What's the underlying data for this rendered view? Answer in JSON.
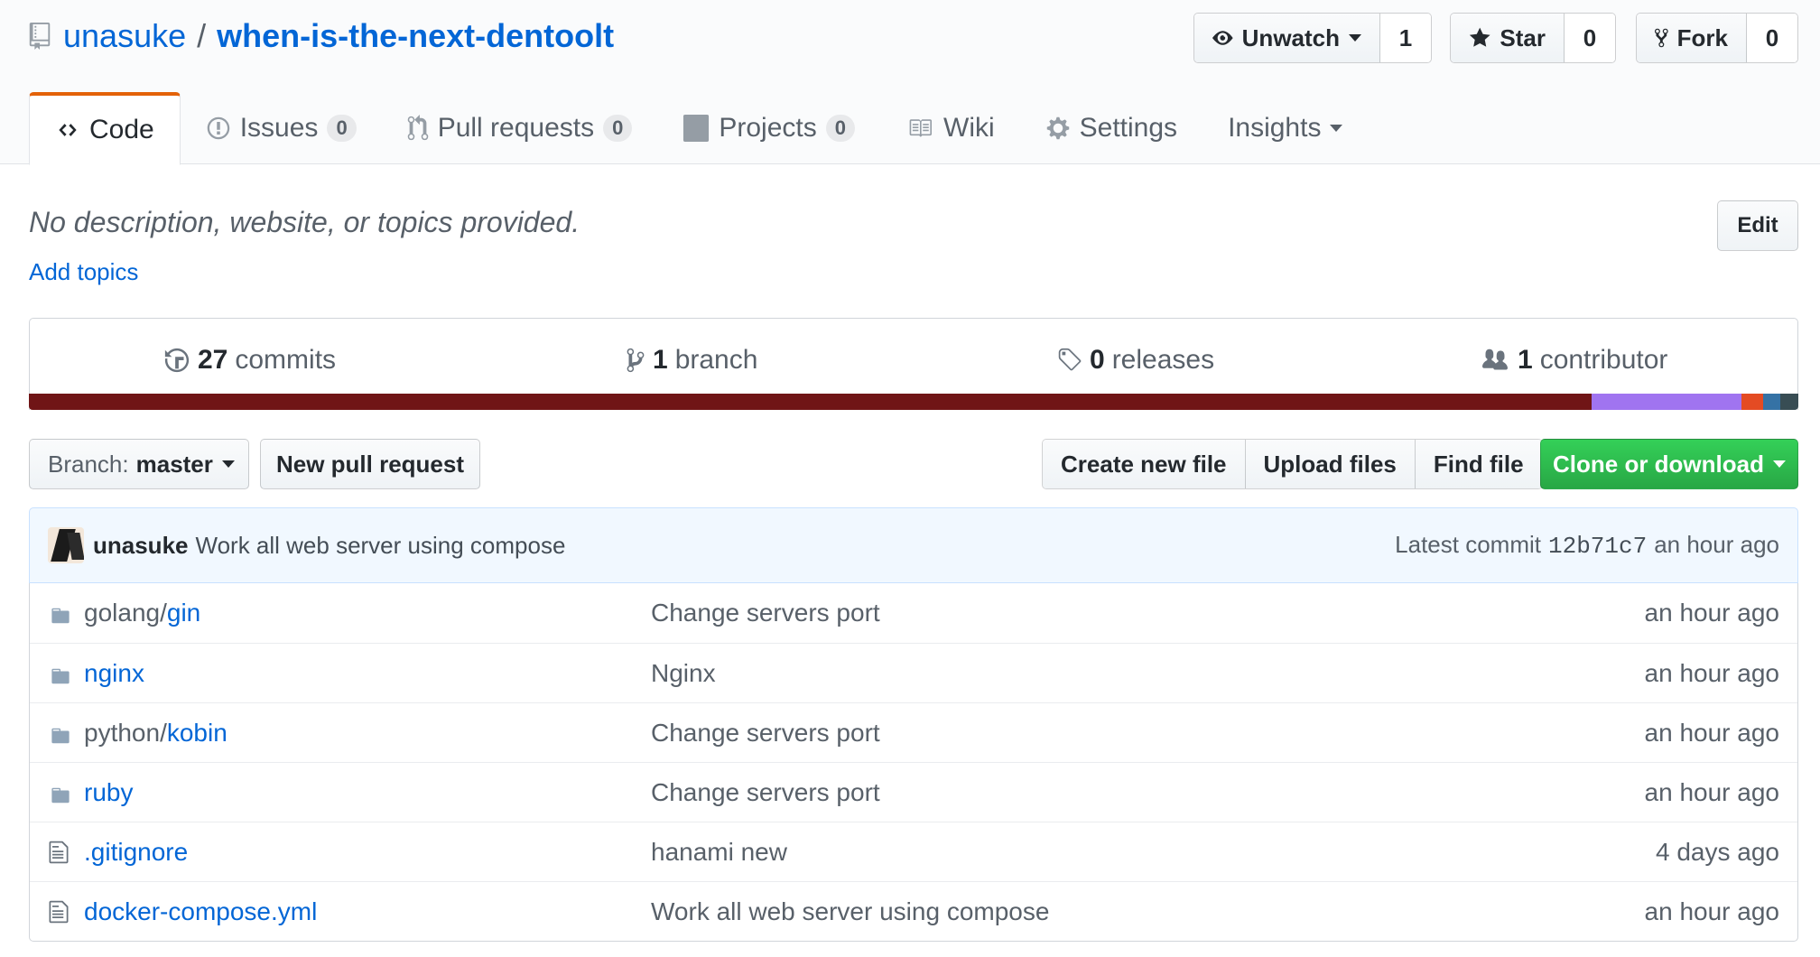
{
  "repo": {
    "owner": "unasuke",
    "separator": "/",
    "name": "when-is-the-next-dentoolt"
  },
  "actions": {
    "watch": {
      "label": "Unwatch",
      "count": "1"
    },
    "star": {
      "label": "Star",
      "count": "0"
    },
    "fork": {
      "label": "Fork",
      "count": "0"
    }
  },
  "tabs": [
    {
      "label": "Code"
    },
    {
      "label": "Issues",
      "count": "0"
    },
    {
      "label": "Pull requests",
      "count": "0"
    },
    {
      "label": "Projects",
      "count": "0"
    },
    {
      "label": "Wiki"
    },
    {
      "label": "Settings"
    },
    {
      "label": "Insights"
    }
  ],
  "about": {
    "description": "No description, website, or topics provided.",
    "add_topics": "Add topics",
    "edit": "Edit"
  },
  "summary": {
    "commits": {
      "num": "27",
      "label": "commits"
    },
    "branches": {
      "num": "1",
      "label": "branch"
    },
    "releases": {
      "num": "0",
      "label": "releases"
    },
    "contributors": {
      "num": "1",
      "label": "contributor"
    }
  },
  "languages": [
    {
      "percent": 88.3,
      "color": "#701516"
    },
    {
      "percent": 8.5,
      "color": "#a074f0"
    },
    {
      "percent": 1.2,
      "color": "#e44b23"
    },
    {
      "percent": 1.0,
      "color": "#3572A5"
    },
    {
      "percent": 1.0,
      "color": "#384d54"
    }
  ],
  "toolbar": {
    "branch_label": "Branch:",
    "branch_name": "master",
    "new_pr": "New pull request",
    "create_file": "Create new file",
    "upload_files": "Upload files",
    "find_file": "Find file",
    "clone": "Clone or download"
  },
  "latest_commit": {
    "author": "unasuke",
    "message": "Work all web server using compose",
    "prefix": "Latest commit",
    "sha": "12b71c7",
    "age": "an hour ago"
  },
  "files": [
    {
      "type": "dir",
      "dir_prefix": "golang/",
      "link": "gin",
      "message": "Change servers port",
      "age": "an hour ago"
    },
    {
      "type": "dir",
      "dir_prefix": "",
      "link": "nginx",
      "message": "Nginx",
      "age": "an hour ago"
    },
    {
      "type": "dir",
      "dir_prefix": "python/",
      "link": "kobin",
      "message": "Change servers port",
      "age": "an hour ago"
    },
    {
      "type": "dir",
      "dir_prefix": "",
      "link": "ruby",
      "message": "Change servers port",
      "age": "an hour ago"
    },
    {
      "type": "file",
      "dir_prefix": "",
      "link": ".gitignore",
      "message": "hanami new",
      "age": "4 days ago"
    },
    {
      "type": "file",
      "dir_prefix": "",
      "link": "docker-compose.yml",
      "message": "Work all web server using compose",
      "age": "an hour ago"
    }
  ]
}
